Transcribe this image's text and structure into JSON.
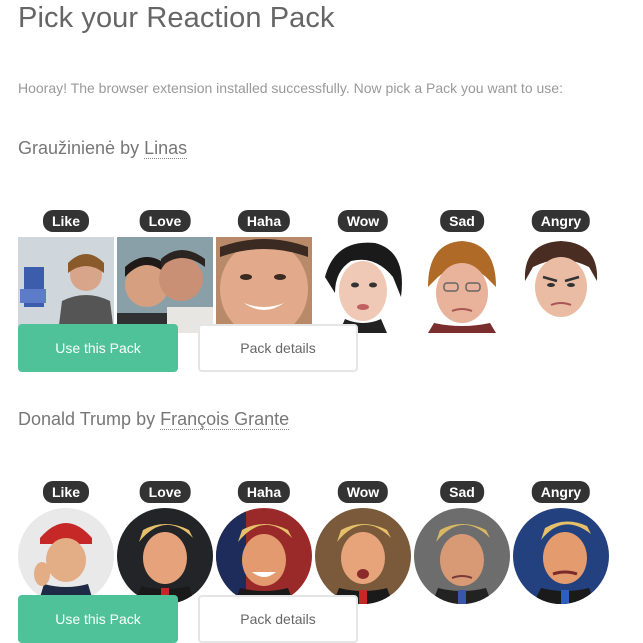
{
  "title": "Pick your Reaction Pack",
  "intro": "Hooray! The browser extension installed successfully. Now pick a Pack you want to use:",
  "packs": [
    {
      "name": "Graužinienė",
      "by": "by",
      "author": "Linas",
      "reactions": [
        "Like",
        "Love",
        "Haha",
        "Wow",
        "Sad",
        "Angry"
      ],
      "use_label": "Use this Pack",
      "details_label": "Pack details"
    },
    {
      "name": "Donald Trump",
      "by": "by",
      "author": "François Grante",
      "reactions": [
        "Like",
        "Love",
        "Haha",
        "Wow",
        "Sad",
        "Angry"
      ],
      "use_label": "Use this Pack",
      "details_label": "Pack details"
    }
  ],
  "colors": {
    "primary": "#4fc29a",
    "badge": "#333333"
  }
}
